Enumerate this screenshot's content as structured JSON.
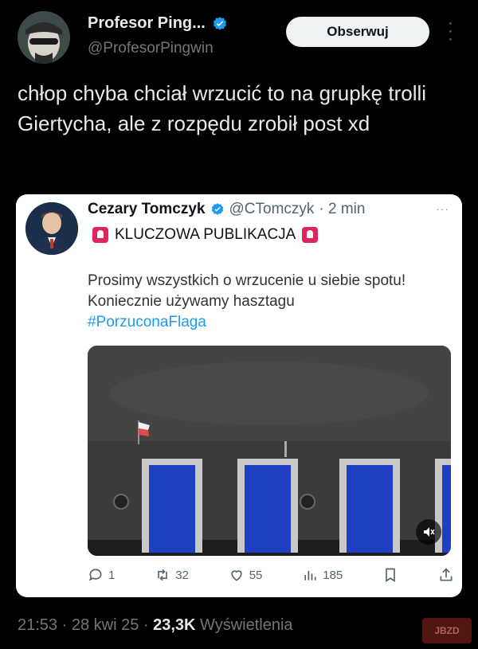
{
  "author": {
    "display_name": "Profesor Ping...",
    "handle": "@ProfesorPingwin",
    "verified": true
  },
  "follow_button": {
    "label": "Obserwuj"
  },
  "tweet": {
    "text": "chłop chyba chciał wrzucić to na grupkę trolli Giertycha, ale z rozpędu zrobił post xd"
  },
  "quoted": {
    "display_name": "Cezary Tomczyk",
    "handle": "@CTomczyk",
    "time": "· 2 min",
    "more": "···",
    "badge_text": "KLUCZOWA PUBLIKACJA",
    "body": "Prosimy wszystkich o wrzucenie u siebie spotu! Koniecznie używamy hasztagu",
    "hashtag": "#PorzuconaFlaga",
    "stats": {
      "replies": "1",
      "retweets": "32",
      "likes": "55",
      "views": "185"
    }
  },
  "meta": {
    "time": "21:53 · 28 kwi 25 ·",
    "views_count": "23,3K",
    "views_label": "Wyświetlenia"
  },
  "watermark": "JBZD",
  "colors": {
    "accent": "#1d9bf0",
    "badge": "#e0245e",
    "podium_blue": "#1f3fc2"
  }
}
